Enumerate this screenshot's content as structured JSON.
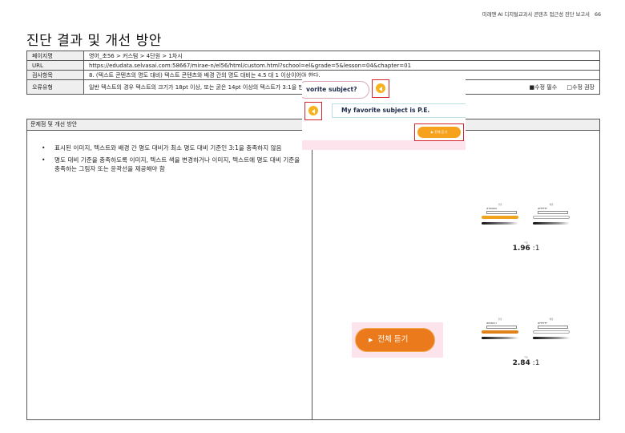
{
  "header": {
    "report_title": "미래엔 AI 디지털교과서 콘텐츠 접근성 진단 보고서",
    "page_number": "66"
  },
  "title": "진단 결과 및 개선 방안",
  "info": {
    "page_label": "페이지명",
    "page_value": "영어_초56 > 커스텀 > 4단원 > 1차시",
    "url_label": "URL",
    "url_value": "https://edudata.selvasai.com:58667/mirae-n/el56/html/custom.html?school=el&grade=5&lesson=04&chapter=01",
    "check_label": "검사항목",
    "check_value": "8. (텍스트 콘텐츠의 명도 대비) 텍스트 콘텐츠와 배경 간의 명도 대비는 4.5 대 1 이상이어야 한다.",
    "error_label": "오류유형",
    "error_value": "일반 텍스트의 경우 텍스트의 크기가 18pt 이상, 또는 굵은 14pt 이상의 텍스트가 3:1을 만족하지 않은 경우",
    "required_label": "■수정 필수",
    "recommended_label": "□수정 권장"
  },
  "section": {
    "title": "문제점 및 개선 방안",
    "bullets": [
      "표시된 이미지, 텍스트와 배경 간 명도 대비가 최소 명도 대비 기준인 3:1을 충족하지 않음",
      "명도 대비 기준을 충족하도록 이미지, 텍스트 색을 변경하거나 이미지, 텍스트에 명도 대비 기준을 충족하는 그림자 또는 윤곽선을 제공해야 함"
    ]
  },
  "screenshot1": {
    "question_text": "vorite subject?",
    "answer_text": "My favorite subject is P.E.",
    "listen_all_label": "▶ 전체 듣기"
  },
  "screenshot2": {
    "listen_all_label": "전체 듣기",
    "play_icon": "▶"
  },
  "checker1": {
    "fg_label": "전경",
    "bg_label": "배경",
    "fg_hex": "#784000",
    "bg_hex": "#FFFFFF",
    "ratio_label": "비율",
    "ratio_value": "1.96",
    "ratio_suffix": ":1",
    "fg_slider_color": "#f2a21c",
    "bg_slider_color": "#ffffff"
  },
  "checker2": {
    "fg_label": "전경",
    "bg_label": "배경",
    "fg_hex": "#E08217",
    "bg_hex": "#FFFFFF",
    "ratio_label": "비율",
    "ratio_value": "2.84",
    "ratio_suffix": ":1",
    "fg_slider_color": "#e08217",
    "bg_slider_color": "#ffffff"
  }
}
